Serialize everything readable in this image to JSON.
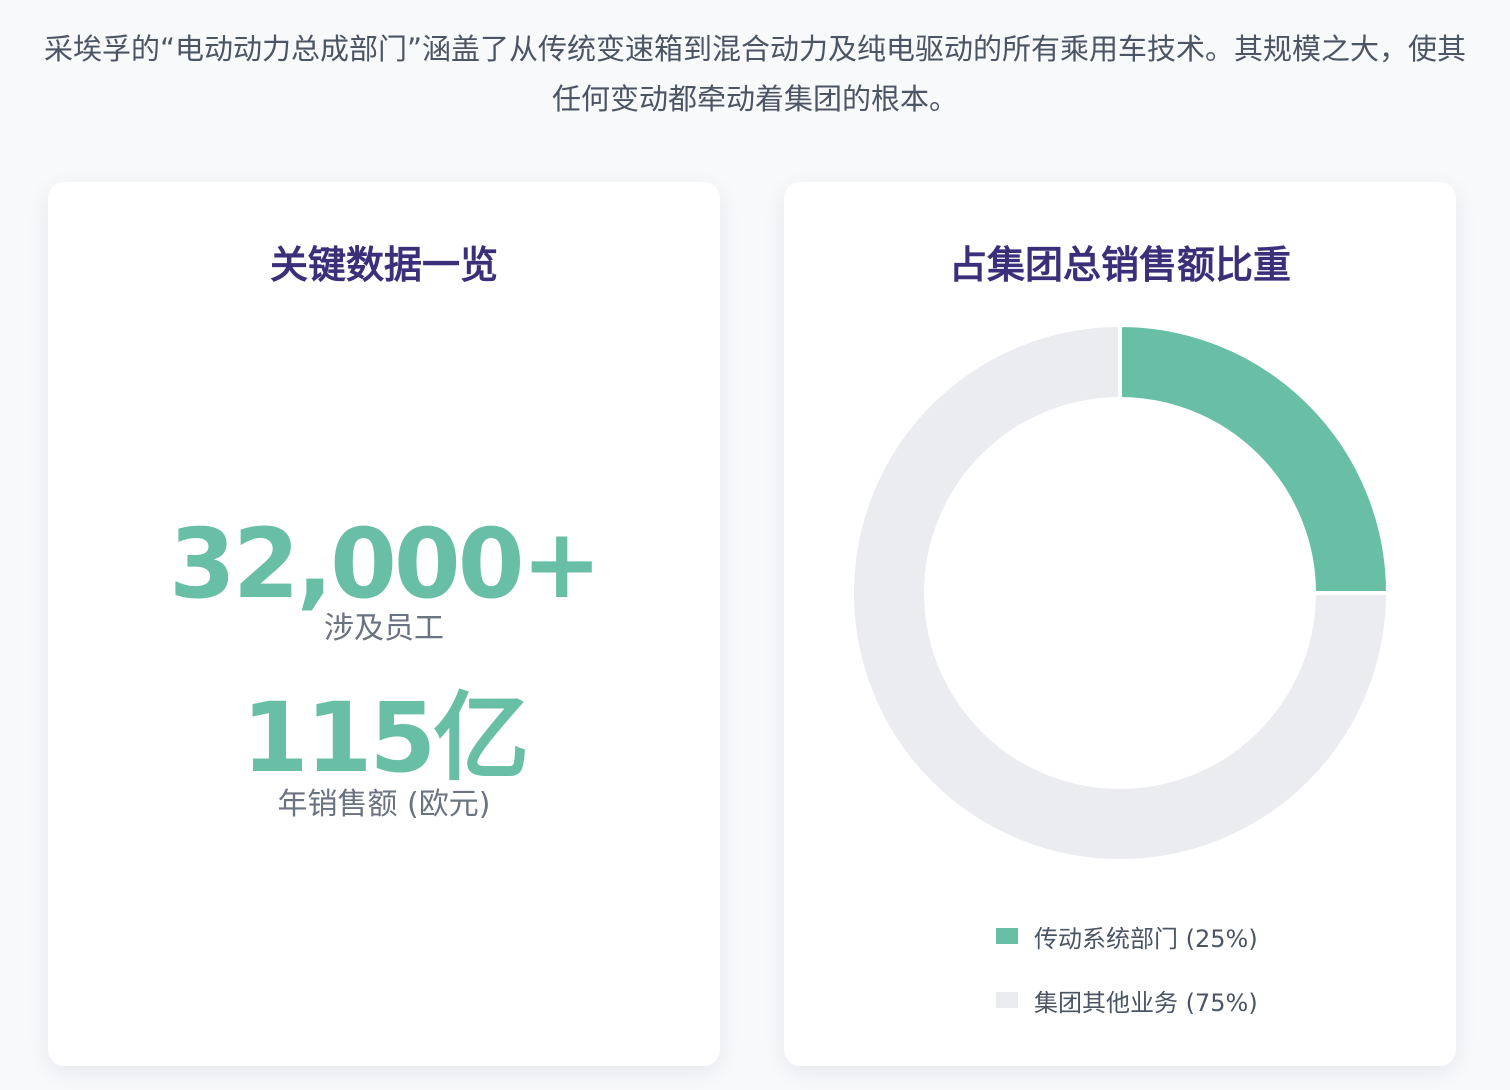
{
  "intro_text": "采埃孚的“电动动力总成部门”涵盖了从传统变速箱到混合动力及纯电驱动的所有乘用车技术。其规模之大，使其任何变动都牵动着集团的根本。",
  "key_data_card": {
    "title": "关键数据一览",
    "stats": [
      {
        "value": "32,000+",
        "label": "涉及员工"
      },
      {
        "value": "115亿",
        "label": "年销售额 (欧元)"
      }
    ]
  },
  "chart_data": {
    "type": "pie",
    "title": "占集团总销售额比重",
    "donut": true,
    "categories": [
      "传动系统部门",
      "集团其他业务"
    ],
    "values": [
      25,
      75
    ],
    "legend_labels": [
      "传动系统部门 (25%)",
      "集团其他业务 (75%)"
    ],
    "colors": [
      "#68bfa5",
      "#ebecf0"
    ],
    "legend_position": "bottom"
  }
}
